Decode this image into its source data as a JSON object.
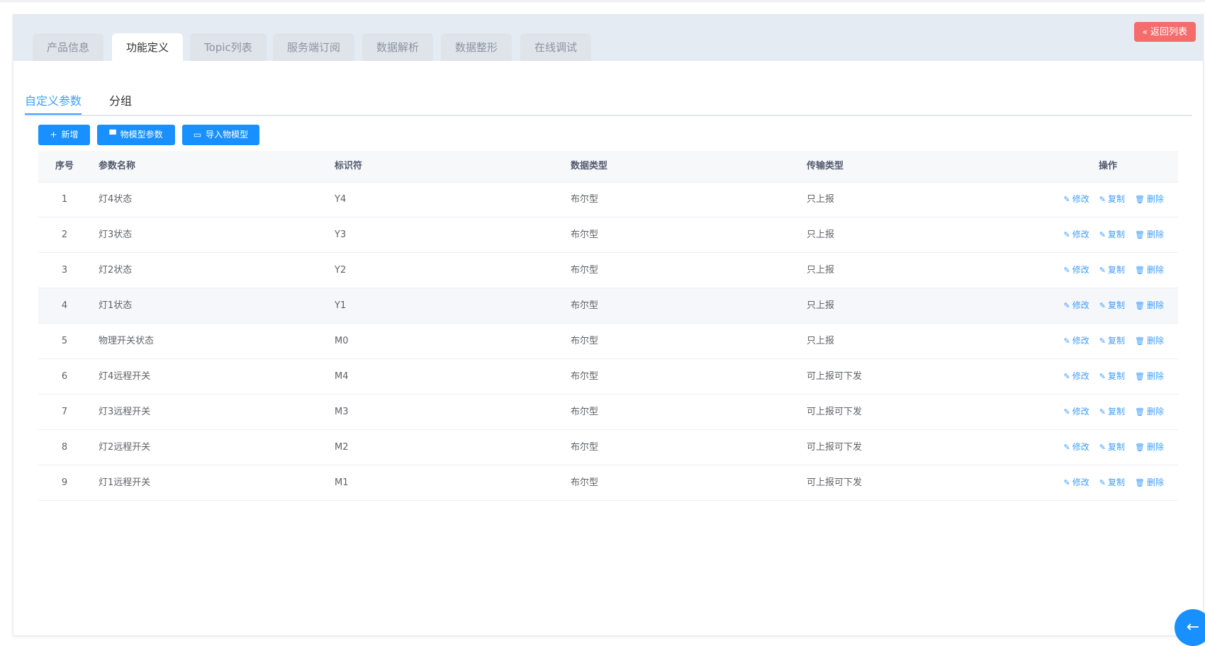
{
  "tabs": [
    {
      "label": "产品信息",
      "active": false
    },
    {
      "label": "功能定义",
      "active": true
    },
    {
      "label": "Topic列表",
      "active": false
    },
    {
      "label": "服务端订阅",
      "active": false
    },
    {
      "label": "数据解析",
      "active": false
    },
    {
      "label": "数据整形",
      "active": false
    },
    {
      "label": "在线调试",
      "active": false
    }
  ],
  "back_button": {
    "label": "返回列表",
    "icon": "double-chevron-left-icon"
  },
  "subtabs": [
    {
      "label": "自定义参数",
      "active": true
    },
    {
      "label": "分组",
      "active": false
    }
  ],
  "toolbar": {
    "add_label": "新增",
    "model_params_label": "物模型参数",
    "import_label": "导入物模型"
  },
  "table": {
    "headers": [
      "序号",
      "参数名称",
      "标识符",
      "数据类型",
      "传输类型",
      "操作"
    ],
    "rows": [
      {
        "idx": "1",
        "name": "灯4状态",
        "id": "Y4",
        "dtype": "布尔型",
        "ttype": "只上报"
      },
      {
        "idx": "2",
        "name": "灯3状态",
        "id": "Y3",
        "dtype": "布尔型",
        "ttype": "只上报"
      },
      {
        "idx": "3",
        "name": "灯2状态",
        "id": "Y2",
        "dtype": "布尔型",
        "ttype": "只上报"
      },
      {
        "idx": "4",
        "name": "灯1状态",
        "id": "Y1",
        "dtype": "布尔型",
        "ttype": "只上报"
      },
      {
        "idx": "5",
        "name": "物理开关状态",
        "id": "M0",
        "dtype": "布尔型",
        "ttype": "只上报"
      },
      {
        "idx": "6",
        "name": "灯4远程开关",
        "id": "M4",
        "dtype": "布尔型",
        "ttype": "可上报可下发"
      },
      {
        "idx": "7",
        "name": "灯3远程开关",
        "id": "M3",
        "dtype": "布尔型",
        "ttype": "可上报可下发"
      },
      {
        "idx": "8",
        "name": "灯2远程开关",
        "id": "M2",
        "dtype": "布尔型",
        "ttype": "可上报可下发"
      },
      {
        "idx": "9",
        "name": "灯1远程开关",
        "id": "M1",
        "dtype": "布尔型",
        "ttype": "可上报可下发"
      }
    ],
    "ops": {
      "edit": "修改",
      "copy": "复制",
      "delete": "删除"
    }
  },
  "colors": {
    "accent": "#1890ff",
    "link": "#409eff",
    "danger": "#f56c6c"
  }
}
